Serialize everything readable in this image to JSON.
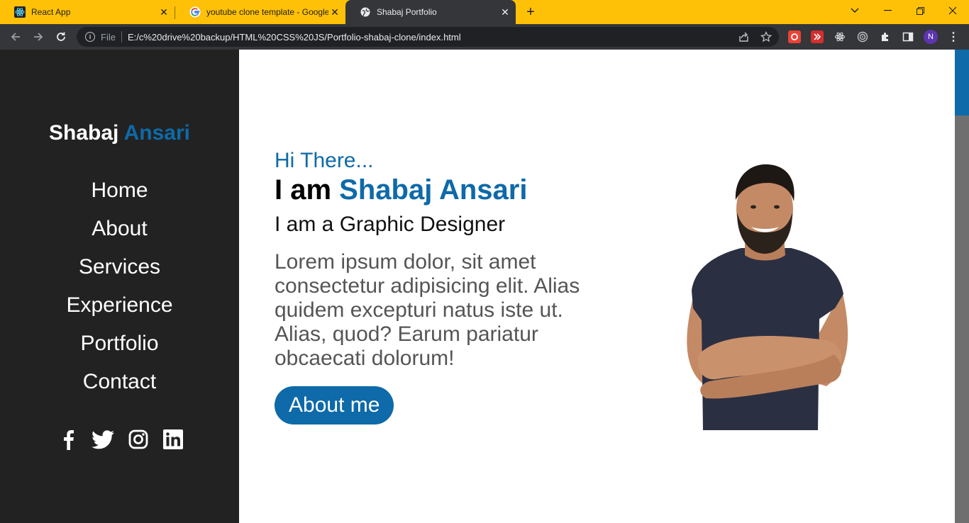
{
  "browser": {
    "tabs": [
      {
        "title": "React App",
        "icon": "react-icon",
        "active": false
      },
      {
        "title": "youtube clone template - Google",
        "icon": "google-icon",
        "active": false
      },
      {
        "title": "Shabaj Portfolio",
        "icon": "globe-icon",
        "active": true
      }
    ],
    "new_tab": "+",
    "address": {
      "scheme_label": "File",
      "url": "E:/c%20drive%20backup/HTML%20CSS%20JS/Portfolio-shabaj-clone/index.html"
    },
    "profile_initial": "N",
    "colors": {
      "tabbar": "#ffc107",
      "toolbar": "#35363a"
    }
  },
  "sidebar": {
    "brand_first": "Shabaj",
    "brand_last": "Ansari",
    "nav": [
      "Home",
      "About",
      "Services",
      "Experience",
      "Portfolio",
      "Contact"
    ],
    "socials": [
      "facebook-icon",
      "twitter-icon",
      "instagram-icon",
      "linkedin-icon"
    ]
  },
  "hero": {
    "greeting": "Hi There...",
    "prefix": "I am",
    "name": "Shabaj Ansari",
    "role": "I am a Graphic Designer",
    "description": "Lorem ipsum dolor, sit amet consectetur adipisicing elit. Alias quidem excepturi natus iste ut. Alias, quod? Earum pariatur obcaecati dolorum!",
    "cta_label": "About me"
  },
  "colors": {
    "accent": "#0e6aa8",
    "sidebar": "#222222"
  }
}
